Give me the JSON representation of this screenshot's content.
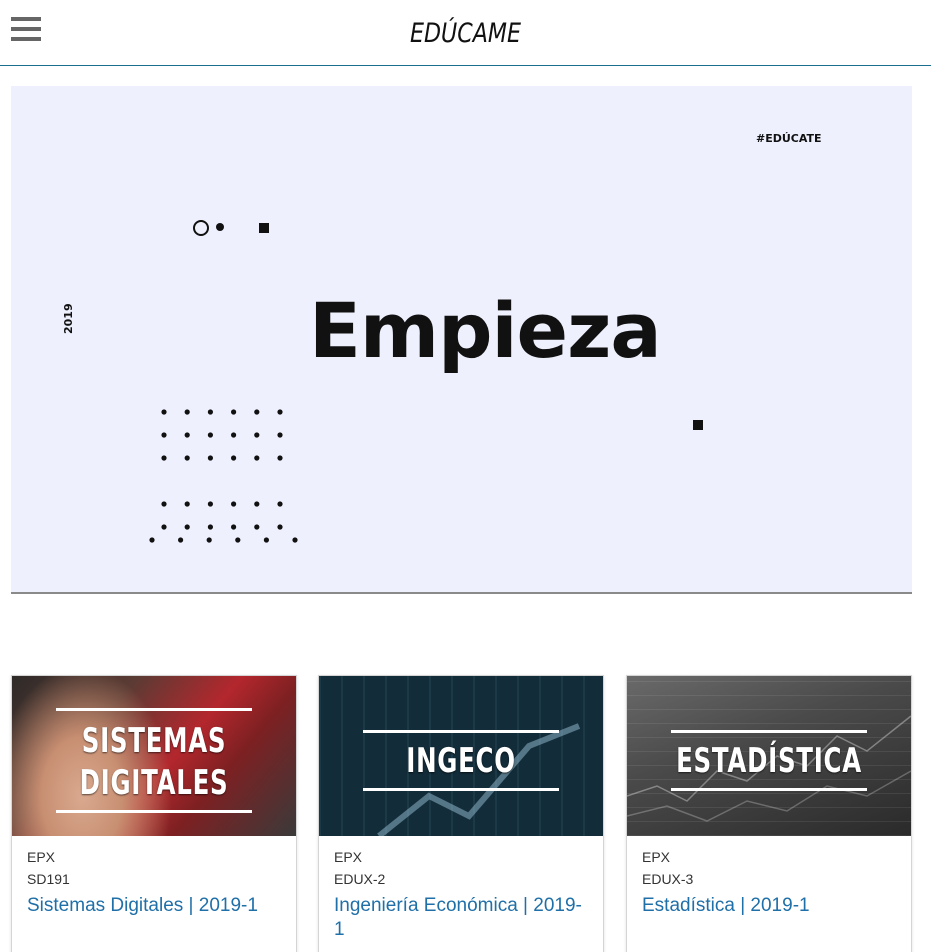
{
  "header": {
    "brand": "EDÚCAME",
    "menu_icon": "hamburger-menu-icon"
  },
  "hero": {
    "hashtag": "#EDÚCATE",
    "year": "2019",
    "headline": "Empieza",
    "background": "#eef1fd"
  },
  "courses": [
    {
      "image_title_lines": [
        "SISTEMAS",
        "DIGITALES"
      ],
      "provider": "EPX",
      "code": "SD191",
      "name": "Sistemas Digitales | 2019-1"
    },
    {
      "image_title_lines": [
        "INGECO"
      ],
      "provider": "EPX",
      "code": "EDUX-2",
      "name": "Ingeniería Económica | 2019-1"
    },
    {
      "image_title_lines": [
        "ESTADÍSTICA"
      ],
      "provider": "EPX",
      "code": "EDUX-3",
      "name": "Estadística | 2019-1"
    }
  ],
  "colors": {
    "accent": "#1f6fa8",
    "header_border": "#1a6e8e"
  }
}
